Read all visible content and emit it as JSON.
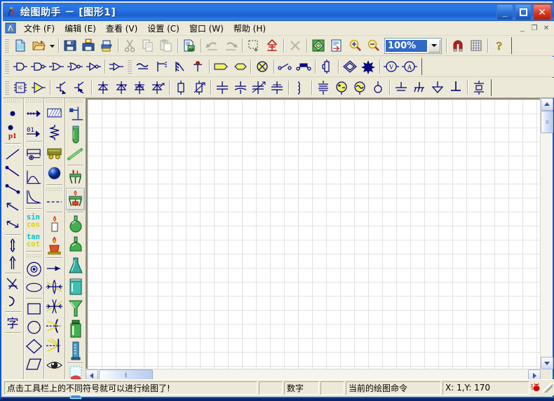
{
  "window": {
    "title": "绘图助手 － [图形1]",
    "app_name": "绘图助手",
    "document_name": "[图形1]",
    "icon": "compass-icon",
    "controls": {
      "minimize": "_",
      "maximize": "▫",
      "close": "✕"
    }
  },
  "menu": {
    "icon": "document-icon",
    "items": [
      {
        "label": "文件 (F)",
        "name": "menu-file"
      },
      {
        "label": "编辑 (E)",
        "name": "menu-edit"
      },
      {
        "label": "查看 (V)",
        "name": "menu-view"
      },
      {
        "label": "设置 (C)",
        "name": "menu-settings"
      },
      {
        "label": "窗口 (W)",
        "name": "menu-window"
      },
      {
        "label": "帮助 (H)",
        "name": "menu-help"
      }
    ],
    "mdi_controls": {
      "minimize": "_",
      "restore": "❐",
      "close": "✕"
    }
  },
  "toolbar_main": {
    "zoom_value": "100%",
    "items": [
      {
        "name": "new-file-icon",
        "tip": "新建"
      },
      {
        "name": "open-file-icon",
        "tip": "打开"
      },
      {
        "name": "open-dropdown-arrow-icon",
        "tip": "最近文件"
      },
      {
        "name": "save-icon",
        "tip": "保存"
      },
      {
        "name": "save-as-icon",
        "tip": "另存为"
      },
      {
        "name": "print-icon",
        "tip": "打印"
      },
      {
        "name": "cut-icon",
        "tip": "剪切"
      },
      {
        "name": "copy-icon",
        "tip": "复制"
      },
      {
        "name": "paste-icon",
        "tip": "粘贴"
      },
      {
        "name": "insert-image-icon",
        "tip": "插入图片"
      },
      {
        "name": "undo-icon",
        "tip": "撤销"
      },
      {
        "name": "redo-icon",
        "tip": "重做"
      },
      {
        "name": "select-region-icon",
        "tip": "选择区域"
      },
      {
        "name": "select-all-icon",
        "tip": "全选"
      },
      {
        "name": "delete-icon",
        "tip": "删除"
      },
      {
        "name": "color-palette-icon",
        "tip": "颜色"
      },
      {
        "name": "page-setup-icon",
        "tip": "页面设置"
      },
      {
        "name": "zoom-in-icon",
        "tip": "放大"
      },
      {
        "name": "zoom-out-icon",
        "tip": "缩小"
      },
      {
        "name": "zoom-combo",
        "tip": "缩放比例"
      },
      {
        "name": "magnet-icon",
        "tip": "磁吸"
      },
      {
        "name": "grid-icon",
        "tip": "网格"
      },
      {
        "name": "help-icon",
        "tip": "帮助"
      }
    ]
  },
  "toolbar_logic": {
    "items": [
      {
        "name": "and-gate-icon"
      },
      {
        "name": "nand-gate-icon"
      },
      {
        "name": "or-gate-icon"
      },
      {
        "name": "nor-gate-icon"
      },
      {
        "name": "not-gate-icon"
      },
      {
        "name": "buffer-gate-icon"
      },
      {
        "name": "wire-icon"
      },
      {
        "name": "terminal-block-icon"
      },
      {
        "name": "rheostat-icon"
      },
      {
        "name": "pin-node-icon"
      },
      {
        "name": "tag-label-icon"
      },
      {
        "name": "hex-label-icon"
      },
      {
        "name": "crossed-circle-icon"
      },
      {
        "name": "switch-open-icon"
      },
      {
        "name": "switch-double-icon"
      },
      {
        "name": "speaker-icon"
      },
      {
        "name": "diamond-shape-icon"
      },
      {
        "name": "burst-icon"
      },
      {
        "name": "voltmeter-icon"
      },
      {
        "name": "ammeter-icon"
      }
    ]
  },
  "toolbar_components": {
    "items": [
      {
        "name": "ic-chip-icon"
      },
      {
        "name": "amplifier-icon"
      },
      {
        "name": "npn-transistor-icon"
      },
      {
        "name": "pnp-transistor-icon"
      },
      {
        "name": "diode-icon"
      },
      {
        "name": "zener-diode-icon"
      },
      {
        "name": "tunnel-diode-icon"
      },
      {
        "name": "led-diode-icon"
      },
      {
        "name": "resistor-icon"
      },
      {
        "name": "variable-resistor-icon"
      },
      {
        "name": "capacitor-icon"
      },
      {
        "name": "electrolytic-capacitor-icon"
      },
      {
        "name": "variable-capacitor-icon"
      },
      {
        "name": "trimmer-capacitor-icon"
      },
      {
        "name": "inductor-icon"
      },
      {
        "name": "coil-core-icon"
      },
      {
        "name": "dc-source-icon"
      },
      {
        "name": "ac-source-icon"
      },
      {
        "name": "lamp-icon"
      },
      {
        "name": "ground-icon"
      },
      {
        "name": "chassis-ground-icon"
      },
      {
        "name": "earth-ground-icon"
      },
      {
        "name": "signal-ground-icon"
      },
      {
        "name": "battery-icon"
      }
    ]
  },
  "palettes": {
    "columns": [
      {
        "name": "palette-points",
        "groups": [
          {
            "items": [
              {
                "name": "point-icon"
              },
              {
                "name": "labeled-point-icon",
                "label": "p1"
              }
            ]
          },
          {
            "items": [
              {
                "name": "line-icon"
              },
              {
                "name": "ray-icon"
              },
              {
                "name": "segment-icon"
              },
              {
                "name": "arrow-left-icon"
              },
              {
                "name": "double-arrow-icon"
              },
              {
                "name": "double-vertical-arrow-icon"
              },
              {
                "name": "up-arrow-icon"
              }
            ]
          },
          {
            "items": [
              {
                "name": "angle-icon"
              },
              {
                "name": "arc-icon"
              }
            ]
          },
          {
            "items": [
              {
                "name": "text-tool-icon",
                "label": "字"
              }
            ]
          }
        ]
      },
      {
        "name": "palette-motion",
        "groups": [
          {
            "items": [
              {
                "name": "velocity-arrow-icon"
              },
              {
                "name": "ruler-arrow-icon"
              }
            ]
          },
          {
            "items": [
              {
                "name": "cart-icon"
              }
            ]
          },
          {
            "items": [
              {
                "name": "parabola-curve-icon"
              },
              {
                "name": "decay-curve-icon"
              }
            ]
          },
          {
            "items": [
              {
                "name": "sin-cos-icon",
                "label": "sin cos"
              },
              {
                "name": "tan-cot-icon",
                "label": "tan cot"
              }
            ]
          },
          {
            "items": [
              {
                "name": "circle-center-icon"
              },
              {
                "name": "ellipse-icon"
              },
              {
                "name": "rectangle-icon"
              },
              {
                "name": "oval-icon"
              },
              {
                "name": "rhombus-icon"
              },
              {
                "name": "parallelogram-icon"
              }
            ]
          }
        ]
      },
      {
        "name": "palette-mechanics",
        "groups": [
          {
            "items": [
              {
                "name": "hatched-surface-icon"
              },
              {
                "name": "spring-icon"
              },
              {
                "name": "trolley-icon"
              },
              {
                "name": "sphere-icon"
              }
            ]
          },
          {
            "items": [
              {
                "name": "dashed-line-icon"
              },
              {
                "name": "candle-icon"
              },
              {
                "name": "alcohol-burner-icon"
              },
              {
                "name": "light-ray-icon"
              },
              {
                "name": "convex-lens-icon"
              },
              {
                "name": "concave-lens-icon"
              },
              {
                "name": "concave-mirror-icon"
              },
              {
                "name": "plane-mirror-icon"
              },
              {
                "name": "eye-icon"
              }
            ]
          }
        ]
      },
      {
        "name": "palette-chemistry",
        "groups": [
          {
            "items": [
              {
                "name": "stand-clamp-icon"
              },
              {
                "name": "test-tube-icon"
              },
              {
                "name": "glass-rod-icon"
              }
            ]
          },
          {
            "items": [
              {
                "name": "tripod-gauze-icon"
              },
              {
                "name": "tripod-burner-icon",
                "selected": true
              }
            ]
          },
          {
            "items": [
              {
                "name": "round-flask-icon"
              },
              {
                "name": "flat-flask-icon"
              },
              {
                "name": "conical-flask-icon"
              },
              {
                "name": "beaker-icon"
              },
              {
                "name": "funnel-icon"
              },
              {
                "name": "wide-bottle-icon"
              },
              {
                "name": "measuring-cylinder-icon"
              }
            ]
          },
          {
            "items": [
              {
                "name": "gas-jar-red-icon"
              },
              {
                "name": "gas-jar-blue-icon"
              }
            ]
          }
        ]
      }
    ]
  },
  "canvas": {
    "name": "drawing-canvas",
    "grid_visible": true,
    "grid_size": 20,
    "background": "#ffffff",
    "grid_color": "#e2e2e2"
  },
  "scrollbars": {
    "vertical": {
      "up_arrow": "▲",
      "down_arrow": "▼",
      "thumb_grip": "≡"
    },
    "horizontal": {
      "left_arrow": "◀",
      "right_arrow": "▶",
      "thumb_grip": "⦀"
    }
  },
  "statusbar": {
    "message": "点击工具栏上的不同符号就可以进行绘图了!",
    "panel_small_1": "",
    "num_indicator": "数字",
    "panel_small_2": "",
    "command": "当前的绘图命令",
    "coordinates": "X:    1,Y: 170",
    "icon": "ant-icon"
  },
  "colors": {
    "titlebar_blue": "#1c5fd0",
    "window_face": "#ece9d8",
    "accent_red": "#cc0000",
    "symbol_blue": "#000080",
    "selection_blue": "#316ac5",
    "canvas_white": "#ffffff"
  }
}
